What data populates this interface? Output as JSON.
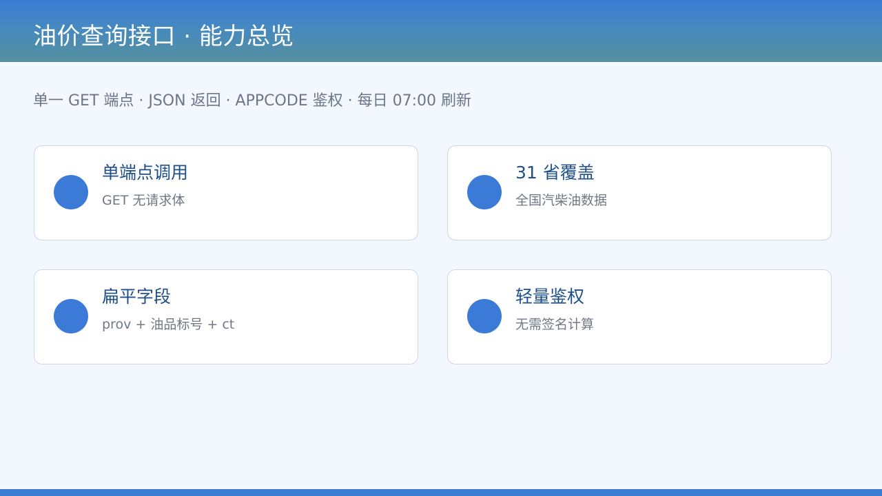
{
  "header": {
    "title": "油价查询接口 · 能力总览"
  },
  "subtitle": "单一 GET 端点 · JSON 返回 · APPCODE 鉴权 · 每日 07:00 刷新",
  "cards": [
    {
      "title": "单端点调用",
      "desc": "GET 无请求体"
    },
    {
      "title": "31 省覆盖",
      "desc": "全国汽柴油数据"
    },
    {
      "title": "扁平字段",
      "desc": "prov + 油品标号 + ct"
    },
    {
      "title": "轻量鉴权",
      "desc": "无需签名计算"
    }
  ],
  "colors": {
    "accent": "#3b7ad6",
    "header_top": "#3a7bd3",
    "header_bottom": "#55909e",
    "background": "#f3f8fe",
    "card_title": "#1e4f8c"
  },
  "icons": {
    "card_marker": "circle-dot-icon"
  }
}
